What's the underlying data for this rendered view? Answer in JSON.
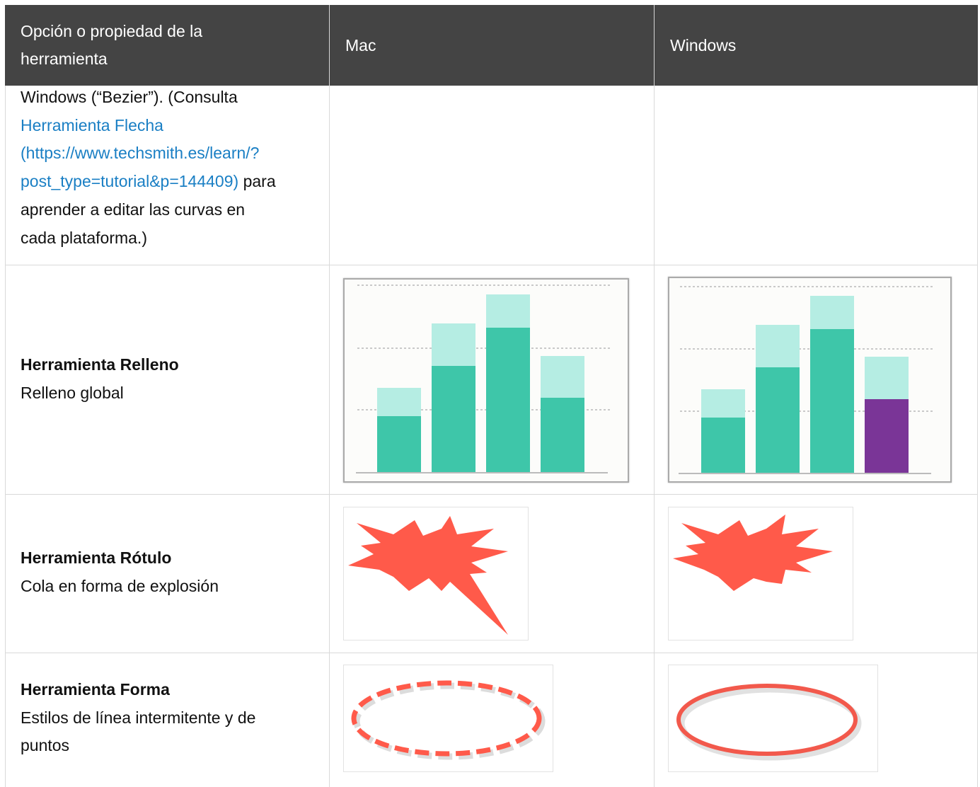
{
  "header": {
    "col1": "Opción o propiedad de la herramienta",
    "col2": "Mac",
    "col3": "Windows"
  },
  "rows": [
    {
      "text_before_link": "Windows (“Bezier”). (Consulta",
      "link_text_1": "Herramienta Flecha",
      "link_text_2": "(https://www.techsmith.es/learn/?",
      "link_text_3": "post_type=tutorial&p=144409)",
      "text_after_link_1": "para",
      "text_after_link_2": "aprender a editar las curvas en",
      "text_after_link_3": "cada plataforma.)"
    },
    {
      "title": "Herramienta Relleno",
      "subtitle": "Relleno global",
      "mac_image": "bar-chart-fill-mac",
      "windows_image": "bar-chart-fill-windows"
    },
    {
      "title": "Herramienta Rótulo",
      "subtitle": "Cola en forma de explosión",
      "mac_image": "explosion-callout-with-tail",
      "windows_image": "explosion-callout"
    },
    {
      "title": "Herramienta Forma",
      "subtitle_line1": "Estilos de línea intermitente y de",
      "subtitle_line2": "puntos",
      "mac_image": "dashed-ellipse",
      "windows_image": "solid-ellipse"
    }
  ],
  "colors": {
    "header_bg": "#444444",
    "link": "#1a7fc4",
    "bar_dark": "#3ec6a9",
    "bar_light": "#b5ede3",
    "highlight_bar": "#7a3597",
    "callout": "#ff5a4a"
  }
}
